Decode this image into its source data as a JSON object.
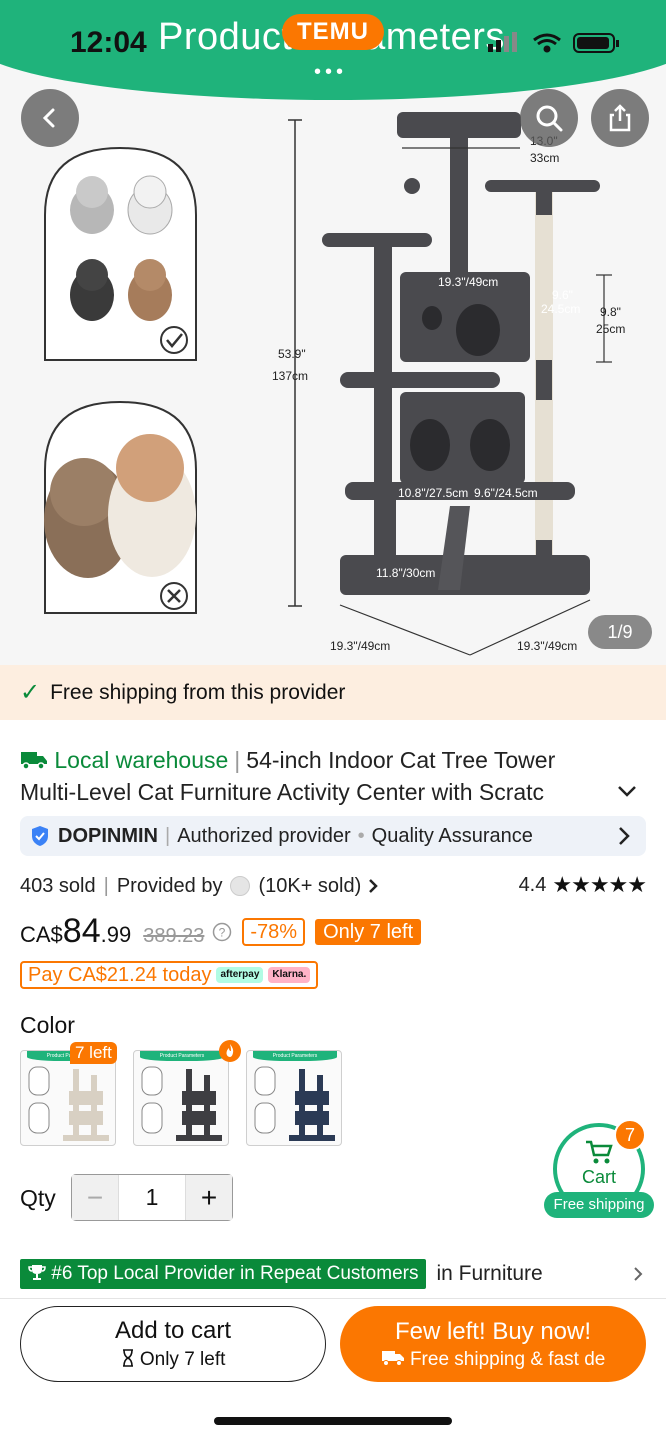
{
  "status_bar": {
    "time": "12:04"
  },
  "hero": {
    "banner_title": "Product Parameters",
    "brand_logo": "TEMU",
    "page_counter": "1/9",
    "dimension_labels": {
      "total_height": "53.9\"",
      "total_height_cm": "137cm",
      "top_perch": "13.0\"",
      "top_perch_cm": "33cm",
      "condo_width": "19.3\"/49cm",
      "condo_depth": "9.6\"",
      "condo_depth_cm": "24.5cm",
      "condo_height": "9.8\"",
      "condo_height_cm": "25cm",
      "lower_condo": "10.8\"/27.5cm",
      "lower_condo_depth": "9.6\"/24.5cm",
      "ramp": "11.8\"/30cm",
      "base_width": "19.3\"/49cm",
      "base_depth": "19.3\"/49cm"
    },
    "icons": {
      "back": "chevron-left-icon",
      "search": "search-icon",
      "share": "share-icon"
    }
  },
  "shipping_strip": {
    "text": "Free shipping from this provider"
  },
  "title": {
    "local_tag": "Local warehouse",
    "line1": "54-inch Indoor Cat Tree Tower",
    "line2": "Multi-Level Cat Furniture Activity Center with Scratc"
  },
  "provider": {
    "name": "DOPINMIN",
    "status": "Authorized provider",
    "quality": "Quality Assurance"
  },
  "sales": {
    "sold": "403 sold",
    "provided_by": "Provided by",
    "provider_sold": "(10K+ sold)",
    "rating": "4.4",
    "stars": "★★★★★"
  },
  "price": {
    "currency": "CA$",
    "main": "84",
    "cents": ".99",
    "original": "389.23",
    "discount": "-78%",
    "stock": "Only 7 left"
  },
  "pay_today": {
    "text": "Pay CA$21.24 today",
    "afterpay": "afterpay",
    "klarna": "Klarna."
  },
  "color": {
    "label": "Color",
    "swatch_badge": "7 left",
    "swatch_header": "Product Parameters",
    "options": [
      {
        "color": "#d8d0c3"
      },
      {
        "color": "#3e3e42"
      },
      {
        "color": "#2b3a55"
      }
    ]
  },
  "qty": {
    "label": "Qty",
    "value": "1",
    "minus": "−",
    "plus": "+"
  },
  "floating_cart": {
    "label": "Cart",
    "count": "7",
    "badge": "Free shipping"
  },
  "ranking": {
    "badge": "#6 Top Local Provider in Repeat Customers",
    "category": "in Furniture"
  },
  "bottom_bar": {
    "add_to_cart": "Add to cart",
    "add_to_cart_sub": "Only 7 left",
    "buy_now": "Few left! Buy now!",
    "buy_now_sub": "Free shipping & fast de"
  },
  "colors": {
    "temu_green": "#1fb37b",
    "temu_orange": "#fb7701",
    "local_green": "#0a8a3a"
  }
}
